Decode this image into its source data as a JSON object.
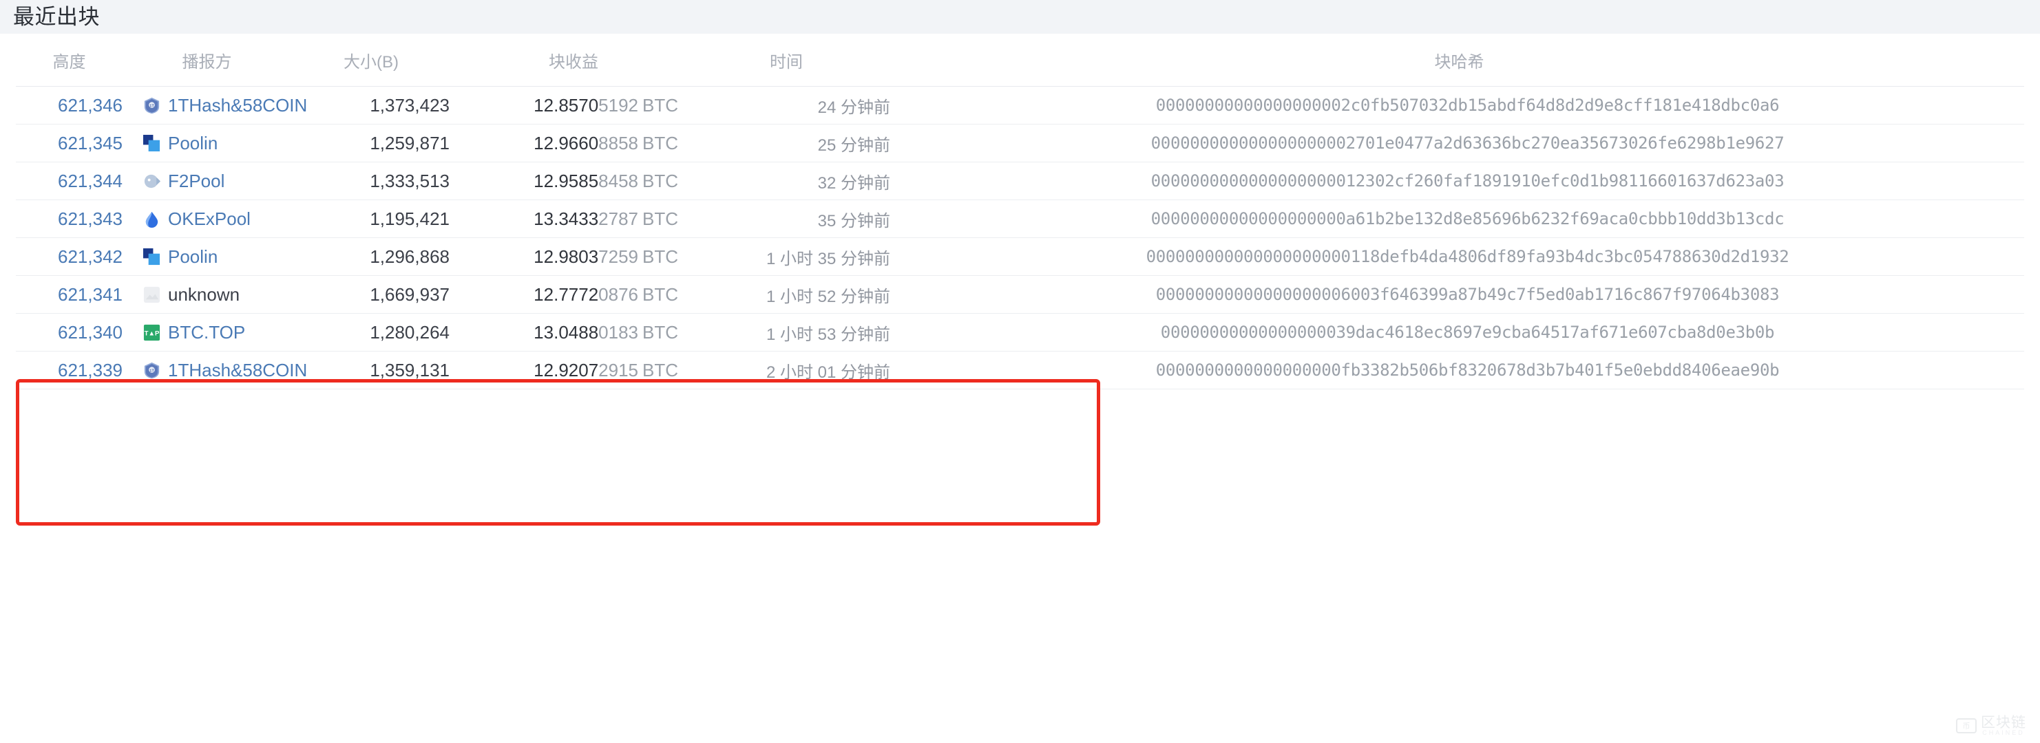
{
  "page": {
    "title": "最近出块"
  },
  "table": {
    "columns": {
      "height": "高度",
      "pool": "播报方",
      "size": "大小(B)",
      "reward": "块收益",
      "time": "时间",
      "hash": "块哈希"
    },
    "rows": [
      {
        "height": "621,346",
        "pool": "1THash&58COIN",
        "pool_icon": "1thash-logo-icon",
        "size": "1,373,423",
        "reward_main": "12.8570",
        "reward_dim": "5192",
        "reward_unit": "BTC",
        "time": "24 分钟前",
        "hash": "00000000000000000002c0fb507032db15abdf64d8d2d9e8cff181e418dbc0a6",
        "highlighted": false
      },
      {
        "height": "621,345",
        "pool": "Poolin",
        "pool_icon": "poolin-logo-icon",
        "size": "1,259,871",
        "reward_main": "12.9660",
        "reward_dim": "8858",
        "reward_unit": "BTC",
        "time": "25 分钟前",
        "hash": "000000000000000000002701e0477a2d63636bc270ea35673026fe6298b1e9627",
        "highlighted": false
      },
      {
        "height": "621,344",
        "pool": "F2Pool",
        "pool_icon": "f2pool-logo-icon",
        "size": "1,333,513",
        "reward_main": "12.9585",
        "reward_dim": "8458",
        "reward_unit": "BTC",
        "time": "32 分钟前",
        "hash": "0000000000000000000012302cf260faf1891910efc0d1b98116601637d623a03",
        "highlighted": false
      },
      {
        "height": "621,343",
        "pool": "OKExPool",
        "pool_icon": "okexpool-logo-icon",
        "size": "1,195,421",
        "reward_main": "13.3433",
        "reward_dim": "2787",
        "reward_unit": "BTC",
        "time": "35 分钟前",
        "hash": "00000000000000000000a61b2be132d8e85696b6232f69aca0cbbb10dd3b13cdc",
        "highlighted": true
      },
      {
        "height": "621,342",
        "pool": "Poolin",
        "pool_icon": "poolin-logo-icon",
        "size": "1,296,868",
        "reward_main": "12.9803",
        "reward_dim": "7259",
        "reward_unit": "BTC",
        "time": "1 小时 35 分钟前",
        "hash": "000000000000000000000118defb4da4806df89fa93b4dc3bc054788630d2d1932",
        "highlighted": true
      },
      {
        "height": "621,341",
        "pool": "unknown",
        "pool_icon": "unknown-pool-icon",
        "size": "1,669,937",
        "reward_main": "12.7772",
        "reward_dim": "0876",
        "reward_unit": "BTC",
        "time": "1 小时 52 分钟前",
        "hash": "00000000000000000006003f646399a87b49c7f5ed0ab1716c867f97064b3083",
        "highlighted": false
      },
      {
        "height": "621,340",
        "pool": "BTC.TOP",
        "pool_icon": "btctop-logo-icon",
        "size": "1,280,264",
        "reward_main": "13.0488",
        "reward_dim": "0183",
        "reward_unit": "BTC",
        "time": "1 小时 53 分钟前",
        "hash": "00000000000000000039dac4618ec8697e9cba64517af671e607cba8d0e3b0b",
        "highlighted": false
      },
      {
        "height": "621,339",
        "pool": "1THash&58COIN",
        "pool_icon": "1thash-logo-icon",
        "size": "1,359,131",
        "reward_main": "12.9207",
        "reward_dim": "2915",
        "reward_unit": "BTC",
        "time": "2 小时 01 分钟前",
        "hash": "0000000000000000000fb3382b506bf8320678d3b7b401f5e0ebdd8406eae90b",
        "highlighted": false
      }
    ]
  },
  "watermark": {
    "cn": "区块链",
    "en": "CHAINED",
    "badge": "币"
  },
  "colors": {
    "link": "#4a7ab5",
    "highlight": "#ee2b1f",
    "header_text": "#a9aeb7",
    "page_bg": "#f2f4f7"
  }
}
